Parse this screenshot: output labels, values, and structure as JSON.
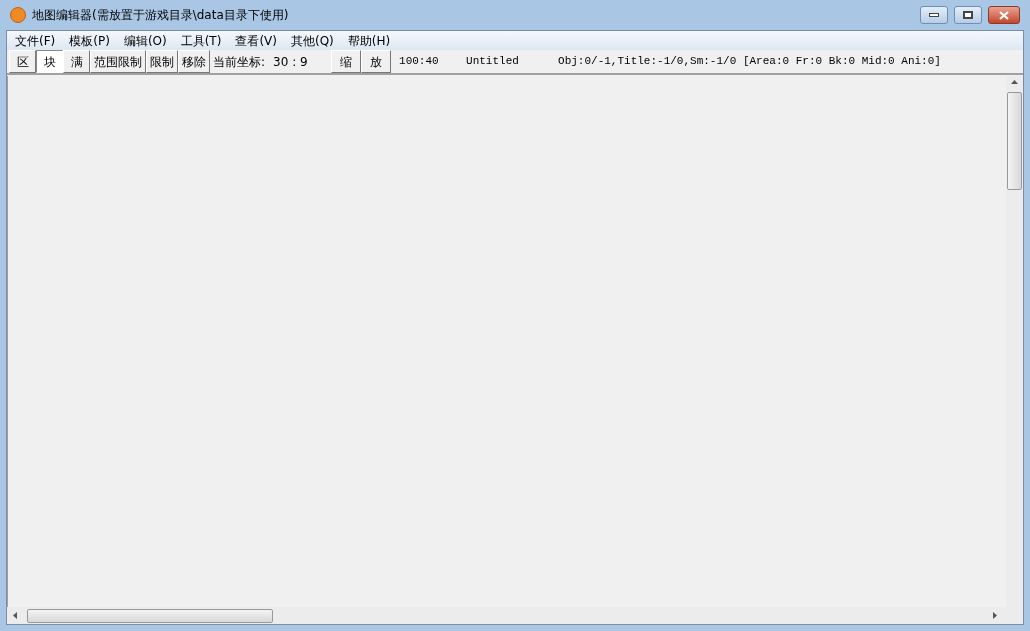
{
  "window": {
    "title": "地图编辑器(需放置于游戏目录\\data目录下使用)"
  },
  "menu": [
    "文件(F)",
    "模板(P)",
    "编辑(O)",
    "工具(T)",
    "查看(V)",
    "其他(Q)",
    "帮助(H)"
  ],
  "toolbar": {
    "tools": [
      {
        "label": "区",
        "selected": false
      },
      {
        "label": "块",
        "selected": true
      },
      {
        "label": "满",
        "selected": false
      },
      {
        "label": "范围限制",
        "selected": false
      },
      {
        "label": "限制",
        "selected": false
      },
      {
        "label": "移除",
        "selected": false
      }
    ],
    "coord_label": "当前坐标:",
    "coord_value": "30 : 9",
    "zoom_buttons": [
      "缩",
      "放"
    ],
    "status": [
      "100:40",
      "Untitled",
      "Obj:0/-1,Title:-1/0,Sm:-1/0 [Area:0 Fr:0 Bk:0 Mid:0 Ani:0]"
    ]
  }
}
